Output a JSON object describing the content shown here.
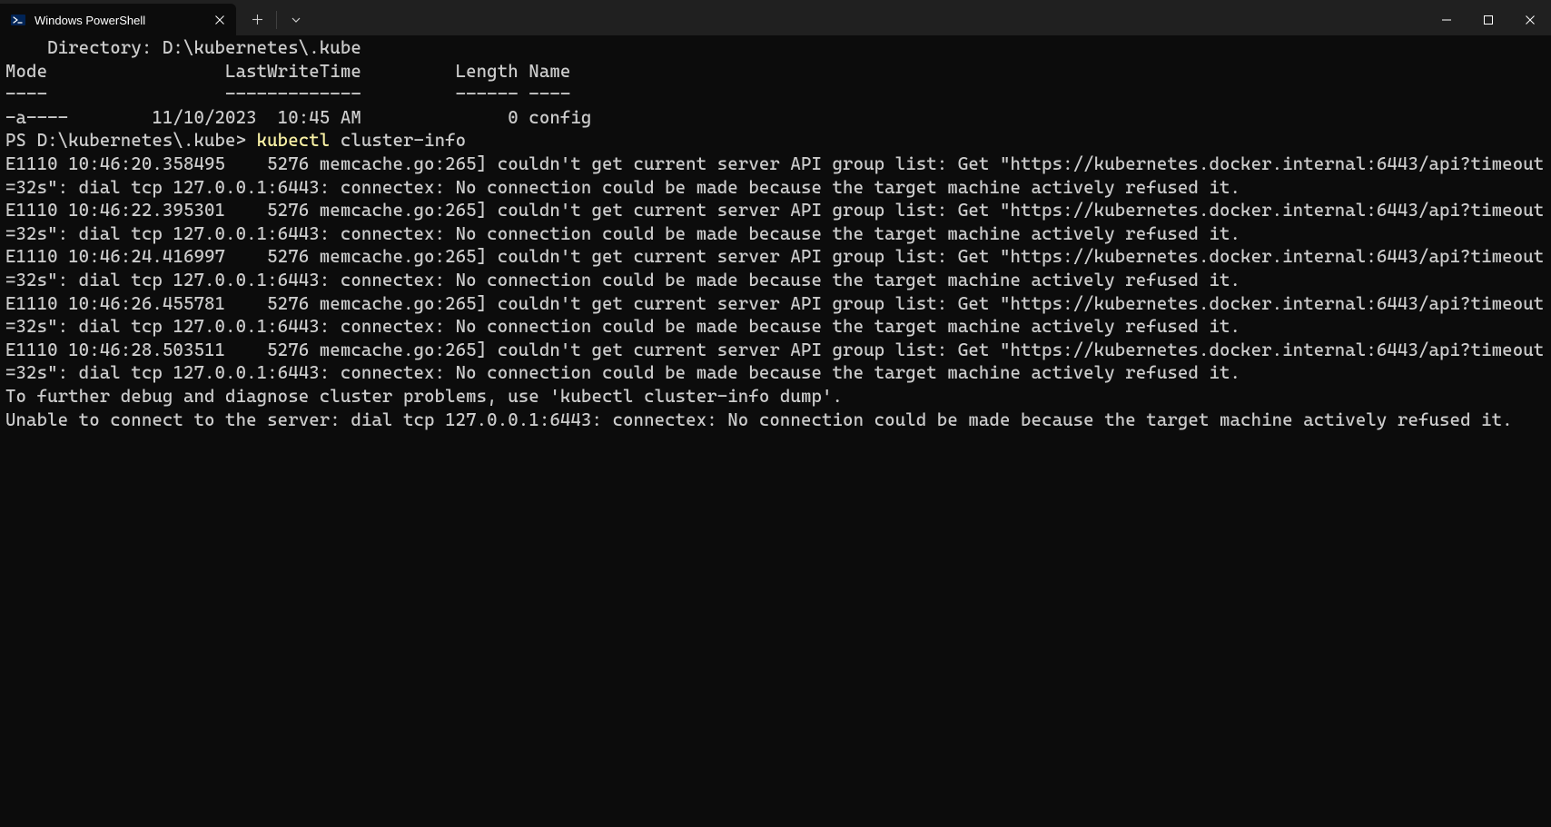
{
  "tab": {
    "title": "Windows PowerShell"
  },
  "terminal": {
    "blank1": "",
    "dir_header": "    Directory: D:\\kubernetes\\.kube",
    "blank2": "",
    "blank3": "",
    "table_header": "Mode                 LastWriteTime         Length Name",
    "table_divider": "----                 -------------         ------ ----",
    "table_row1": "-a----        11/10/2023  10:45 AM              0 config",
    "blank4": "",
    "blank5": "",
    "prompt_prefix": "PS D:\\kubernetes\\.kube> ",
    "cmd_kubectl": "kubectl",
    "cmd_args": " cluster-info",
    "err1": "E1110 10:46:20.358495    5276 memcache.go:265] couldn't get current server API group list: Get \"https://kubernetes.docker.internal:6443/api?timeout=32s\": dial tcp 127.0.0.1:6443: connectex: No connection could be made because the target machine actively refused it.",
    "err2": "E1110 10:46:22.395301    5276 memcache.go:265] couldn't get current server API group list: Get \"https://kubernetes.docker.internal:6443/api?timeout=32s\": dial tcp 127.0.0.1:6443: connectex: No connection could be made because the target machine actively refused it.",
    "err3": "E1110 10:46:24.416997    5276 memcache.go:265] couldn't get current server API group list: Get \"https://kubernetes.docker.internal:6443/api?timeout=32s\": dial tcp 127.0.0.1:6443: connectex: No connection could be made because the target machine actively refused it.",
    "err4": "E1110 10:46:26.455781    5276 memcache.go:265] couldn't get current server API group list: Get \"https://kubernetes.docker.internal:6443/api?timeout=32s\": dial tcp 127.0.0.1:6443: connectex: No connection could be made because the target machine actively refused it.",
    "err5": "E1110 10:46:28.503511    5276 memcache.go:265] couldn't get current server API group list: Get \"https://kubernetes.docker.internal:6443/api?timeout=32s\": dial tcp 127.0.0.1:6443: connectex: No connection could be made because the target machine actively refused it.",
    "blank6": "",
    "footer1": "To further debug and diagnose cluster problems, use 'kubectl cluster-info dump'.",
    "footer2": "Unable to connect to the server: dial tcp 127.0.0.1:6443: connectex: No connection could be made because the target machine actively refused it."
  }
}
